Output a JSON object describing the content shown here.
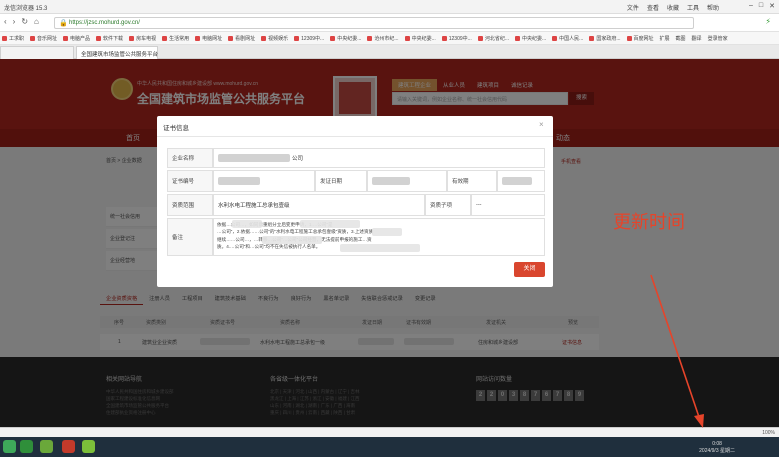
{
  "browser": {
    "title": "龙信浏览器 15.3",
    "menu": [
      "文件",
      "查看",
      "收藏",
      "工具",
      "帮助"
    ],
    "url": "https://jzsc.mohurd.gov.cn/",
    "bookmarks": [
      "工求职",
      "音乐网址",
      "电脑产品",
      "软件下载",
      "房车电视",
      "生活常用",
      "电脑网址",
      "看剧网址",
      "视频娱乐",
      "12309中...",
      "中央纪委...",
      "沧州市纪...",
      "中央纪委...",
      "12309中...",
      "河北省纪...",
      "中央纪委...",
      "中国人民...",
      "国家政府...",
      "百度网址"
    ],
    "bookmark_tools": [
      "扩展",
      "截图",
      "翻译",
      "登录管家"
    ],
    "tabs": [
      "",
      "全国建筑市场监管公共服务平台"
    ]
  },
  "site": {
    "sub_title": "中华人民共和国住房和城乡建设部  www.mohurd.gov.cn",
    "main_title": "全国建筑市场监管公共服务平台",
    "search_tabs": [
      "建筑工程企业",
      "从业人员",
      "建筑项目",
      "诚信记录"
    ],
    "search_placeholder": "请输入关键词，例如企业名称、统一社会信用代码",
    "search_button": "搜索",
    "nav_home": "首页",
    "nav_dynamic": "动态",
    "breadcrumb": "首页 > 企业数据",
    "phone_link": "手机查看",
    "left_items": [
      "统一社会信用",
      "企业登记注",
      "企业经营地"
    ],
    "sub_tabs": [
      "企业资质资格",
      "注册人员",
      "工程项目",
      "建筑技术基础",
      "不良行为",
      "良好行为",
      "黑名单记录",
      "失信联合惩戒记录",
      "变更记录"
    ],
    "table_headers": [
      "序号",
      "资质类别",
      "资质证书号",
      "资质名称",
      "发证日期",
      "证书有效期",
      "发证机关",
      "预览"
    ],
    "table_row": [
      "1",
      "建筑业企业资质",
      "",
      "水利水电工程施工总承包一级",
      "",
      "",
      "住房和城乡建设部",
      "证书信息"
    ]
  },
  "modal": {
    "title": "证书信息",
    "close": "×",
    "labels": {
      "company": "企业名称",
      "cert_no": "证书编号",
      "issue_date": "发证日期",
      "valid_date": "有效期",
      "scope": "资质范围",
      "sub_items": "资质子项",
      "remark": "备注"
    },
    "values": {
      "company_suffix": "公司",
      "scope": "水利水电工程施工总承包壹级",
      "sub_items": "---",
      "remark_l1": "依据…公司…，如同意重组分立后变更申请，1.…公司”是",
      "remark_l2": "…公司”，2.依据……公司”的“水利水电工程施工总承包壹级”资质，3.上述资质",
      "remark_l3": "继续……公司…，…转移…公司”…公司”公司经营，无法提前申报的施工…资",
      "remark_l4": "质。4.…公司”和…公司”均不在失信被执行人名单。"
    },
    "ok_button": "关闭"
  },
  "annotation": "更新时间",
  "footer": {
    "col1_title": "相关网站导航",
    "col1_lines": [
      "中华人民共和国住房和城乡建设部",
      "国家工程建设标准化信息网",
      "全国建筑市场监管公共服务平台",
      "住建部执业资格注册中心"
    ],
    "col2_title": "各省级一体化平台",
    "col2_lines": [
      "北京 | 天津 | 河北 | 山西 | 内蒙古 | 辽宁 | 吉林",
      "黑龙江 | 上海 | 江苏 | 浙江 | 安徽 | 福建 | 江西",
      "山东 | 河南 | 湖北 | 湖南 | 广东 | 广西 | 海南",
      "重庆 | 四川 | 贵州 | 云南 | 西藏 | 陕西 | 甘肃"
    ],
    "col3_title": "网站访问数量",
    "counter": [
      "2",
      "2",
      "0",
      "3",
      "8",
      "7",
      "6",
      "7",
      "8",
      "9"
    ]
  },
  "status": {
    "zoom": "100%",
    "time": "0:08",
    "date": "2024/9/3 星期二"
  },
  "colors": {
    "brand_red": "#b3261e",
    "modal_button": "#d9462e",
    "annotation": "#e6442a"
  }
}
